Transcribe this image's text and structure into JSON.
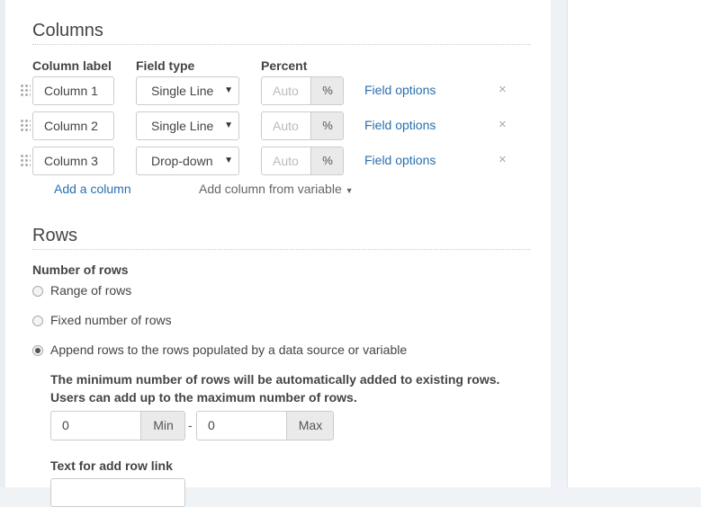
{
  "columns_section": {
    "title": "Columns",
    "headers": {
      "label": "Column label",
      "type": "Field type",
      "percent": "Percent"
    },
    "rows": [
      {
        "label": "Column 1",
        "type": "Single Line",
        "percent_placeholder": "Auto",
        "percent_unit": "%",
        "options_link": "Field options",
        "remove": "×"
      },
      {
        "label": "Column 2",
        "type": "Single Line",
        "percent_placeholder": "Auto",
        "percent_unit": "%",
        "options_link": "Field options",
        "remove": "×"
      },
      {
        "label": "Column 3",
        "type": "Drop-down",
        "percent_placeholder": "Auto",
        "percent_unit": "%",
        "options_link": "Field options",
        "remove": "×"
      }
    ],
    "add_column": "Add a column",
    "add_from_variable": "Add column from variable"
  },
  "rows_section": {
    "title": "Rows",
    "number_of_rows_label": "Number of rows",
    "options": [
      {
        "label": "Range of rows",
        "selected": false
      },
      {
        "label": "Fixed number of rows",
        "selected": false
      },
      {
        "label": "Append rows to the rows populated by a data source or variable",
        "selected": true
      }
    ],
    "help_line1": "The minimum number of rows will be automatically added to existing rows.",
    "help_line2": "Users can add up to the maximum number of rows.",
    "min_value": "0",
    "min_label": "Min",
    "separator": "-",
    "max_value": "0",
    "max_label": "Max",
    "add_row_link_label": "Text for add row link"
  },
  "colors": {
    "link": "#2a6fb0",
    "panel_bg": "#ffffff",
    "page_bg": "#f0f3f6"
  }
}
